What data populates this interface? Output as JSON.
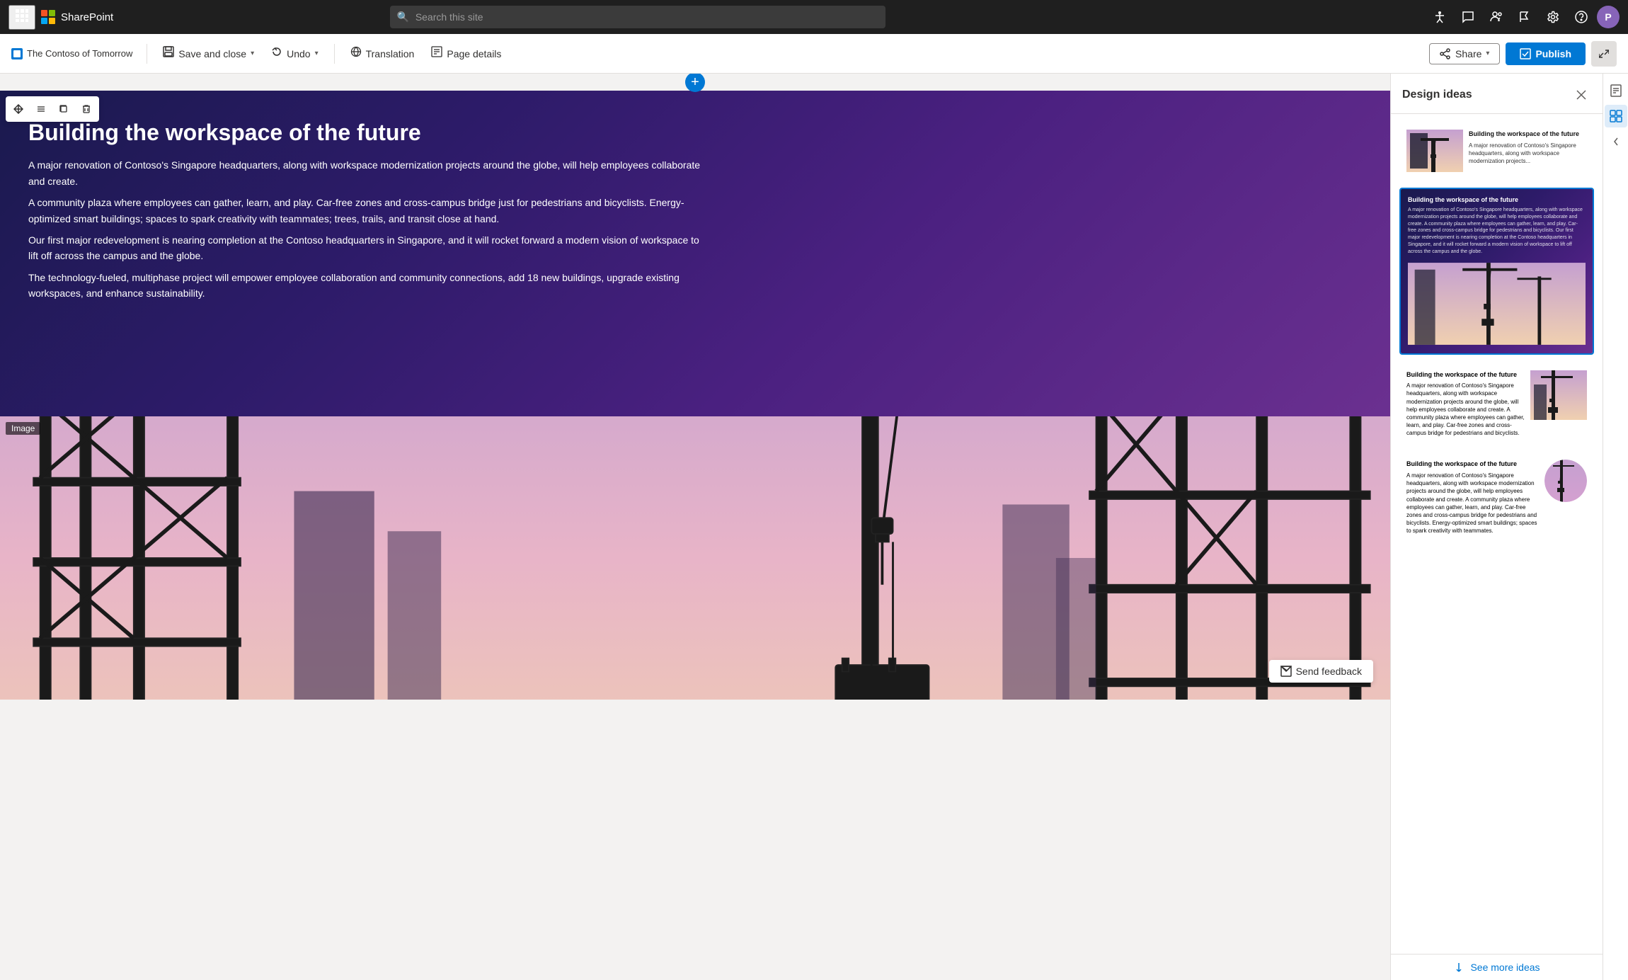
{
  "app": {
    "name": "SharePoint",
    "waffle_label": "⊞"
  },
  "nav": {
    "search_placeholder": "Search this site",
    "icons": [
      "chat",
      "people",
      "flag",
      "settings",
      "help"
    ]
  },
  "toolbar": {
    "site_title": "The Contoso of Tomorrow",
    "save_close_label": "Save and close",
    "undo_label": "Undo",
    "translation_label": "Translation",
    "page_details_label": "Page details",
    "share_label": "Share",
    "publish_label": "Publish"
  },
  "canvas": {
    "add_section_title": "Add a new section",
    "hero": {
      "title": "Building the workspace of the future",
      "paragraphs": [
        "A major renovation of Contoso's Singapore headquarters, along with workspace modernization projects around the globe, will help employees collaborate and create.",
        "A community plaza where employees can gather, learn, and play. Car-free zones and cross-campus bridge just for pedestrians and bicyclists. Energy-optimized smart buildings; spaces to spark creativity with teammates; trees, trails, and transit close at hand.",
        "Our first major redevelopment is nearing completion at the Contoso headquarters in Singapore, and it will rocket forward a modern vision of workspace to lift off across the campus and the globe.",
        "The technology-fueled, multiphase project will empower employee collaboration and community connections, add 18 new buildings, upgrade existing workspaces, and enhance sustainability."
      ]
    },
    "image_label": "Image",
    "send_feedback_label": "Send feedback"
  },
  "design_ideas": {
    "title": "Design ideas",
    "close_label": "×",
    "see_more_label": "See more ideas",
    "cards": [
      {
        "id": 1,
        "type": "side-image",
        "selected": false
      },
      {
        "id": 2,
        "type": "full-dark",
        "selected": true
      },
      {
        "id": 3,
        "type": "text-image-right",
        "selected": false
      },
      {
        "id": 4,
        "type": "circle-accent",
        "selected": false
      }
    ],
    "card_title": "Building the workspace of the future",
    "card_body": "A major renovation of Contoso's Singapore headquarters, along with workspace modernization projects around the globe, will help employees collaborate and create."
  },
  "section_controls": {
    "move_icon": "✥",
    "settings_icon": "⚙",
    "duplicate_icon": "⧉",
    "delete_icon": "🗑"
  }
}
